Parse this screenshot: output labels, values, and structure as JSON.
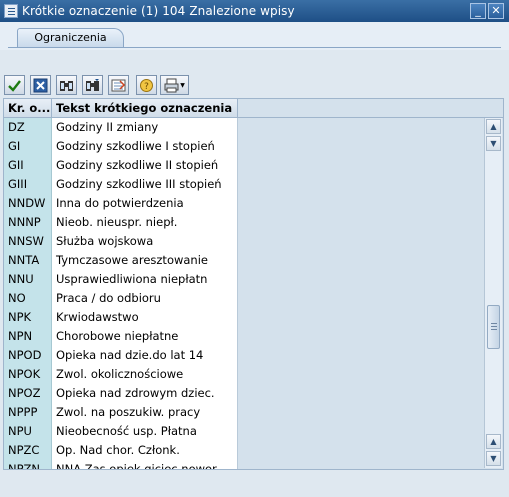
{
  "window": {
    "title": "Krótkie oznaczenie (1)  104 Znalezione wpisy",
    "minimize_label": "_",
    "close_label": "✕"
  },
  "tabs": [
    {
      "label": "Ograniczenia"
    }
  ],
  "toolbar": {
    "buttons": [
      {
        "icon": "checkmark-icon"
      },
      {
        "icon": "cancel-icon"
      },
      {
        "icon": "find-icon"
      },
      {
        "icon": "find-next-icon"
      },
      {
        "icon": "sort-icon"
      },
      {
        "icon": "help-icon"
      },
      {
        "icon": "print-icon"
      }
    ]
  },
  "table": {
    "columns": [
      "Kr. o...",
      "Tekst krótkiego oznaczenia"
    ],
    "rows": [
      {
        "code": "DZ",
        "text": "Godziny II zmiany"
      },
      {
        "code": "GI",
        "text": "Godziny szkodliwe I stopień"
      },
      {
        "code": "GII",
        "text": "Godziny szkodliwe II stopień"
      },
      {
        "code": "GIII",
        "text": "Godziny szkodliwe III stopień"
      },
      {
        "code": "NNDW",
        "text": "Inna do potwierdzenia"
      },
      {
        "code": "NNNP",
        "text": "Nieob. nieuspr. niepł."
      },
      {
        "code": "NNSW",
        "text": "Służba wojskowa"
      },
      {
        "code": "NNTA",
        "text": "Tymczasowe aresztowanie"
      },
      {
        "code": "NNU",
        "text": "Usprawiedliwiona niepłatn"
      },
      {
        "code": "NO",
        "text": "Praca / do odbioru"
      },
      {
        "code": "NPK",
        "text": "Krwiodawstwo"
      },
      {
        "code": "NPN",
        "text": "Chorobowe niepłatne"
      },
      {
        "code": "NPOD",
        "text": "Opieka nad dzie.do lat 14"
      },
      {
        "code": "NPOK",
        "text": "Zwol. okolicznościowe"
      },
      {
        "code": "NPOZ",
        "text": "Opieka nad zdrowym dziec."
      },
      {
        "code": "NPPP",
        "text": "Zwol. na poszukiw. pracy"
      },
      {
        "code": "NPU",
        "text": "Nieobecność usp. Płatna"
      },
      {
        "code": "NPZC",
        "text": "Op. Nad chor. Członk."
      },
      {
        "code": "NPZN",
        "text": "NNA Zas.opiek.giciec nowor."
      }
    ]
  },
  "scrollbar": {
    "up_arrow": "▲",
    "down_arrow": "▼"
  }
}
